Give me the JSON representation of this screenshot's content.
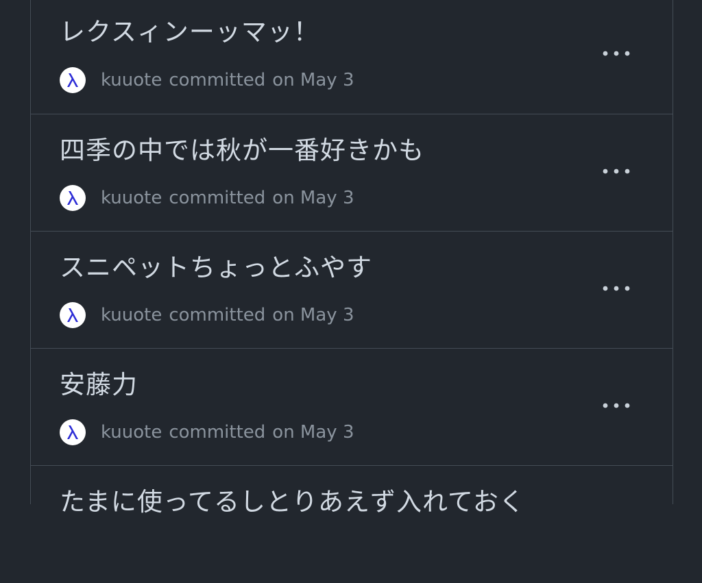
{
  "commits": [
    {
      "title": "レクスィンーッマッ！",
      "author": "kuuote",
      "action": "committed",
      "date": "on May 3"
    },
    {
      "title": "四季の中では秋が一番好きかも",
      "author": "kuuote",
      "action": "committed",
      "date": "on May 3"
    },
    {
      "title": "スニペットちょっとふやす",
      "author": "kuuote",
      "action": "committed",
      "date": "on May 3"
    },
    {
      "title": "安藤力",
      "author": "kuuote",
      "action": "committed",
      "date": "on May 3"
    },
    {
      "title": "たまに使ってるしとりあえず入れておく",
      "author": "",
      "action": "",
      "date": ""
    }
  ],
  "icons": {
    "avatar": "lambda-avatar-icon",
    "more": "kebab-horizontal-icon"
  },
  "colors": {
    "background": "#22272e",
    "border": "#444c56",
    "title": "#d2dae3",
    "meta": "#8b949e",
    "avatar_glyph": "#2b2bd6"
  }
}
